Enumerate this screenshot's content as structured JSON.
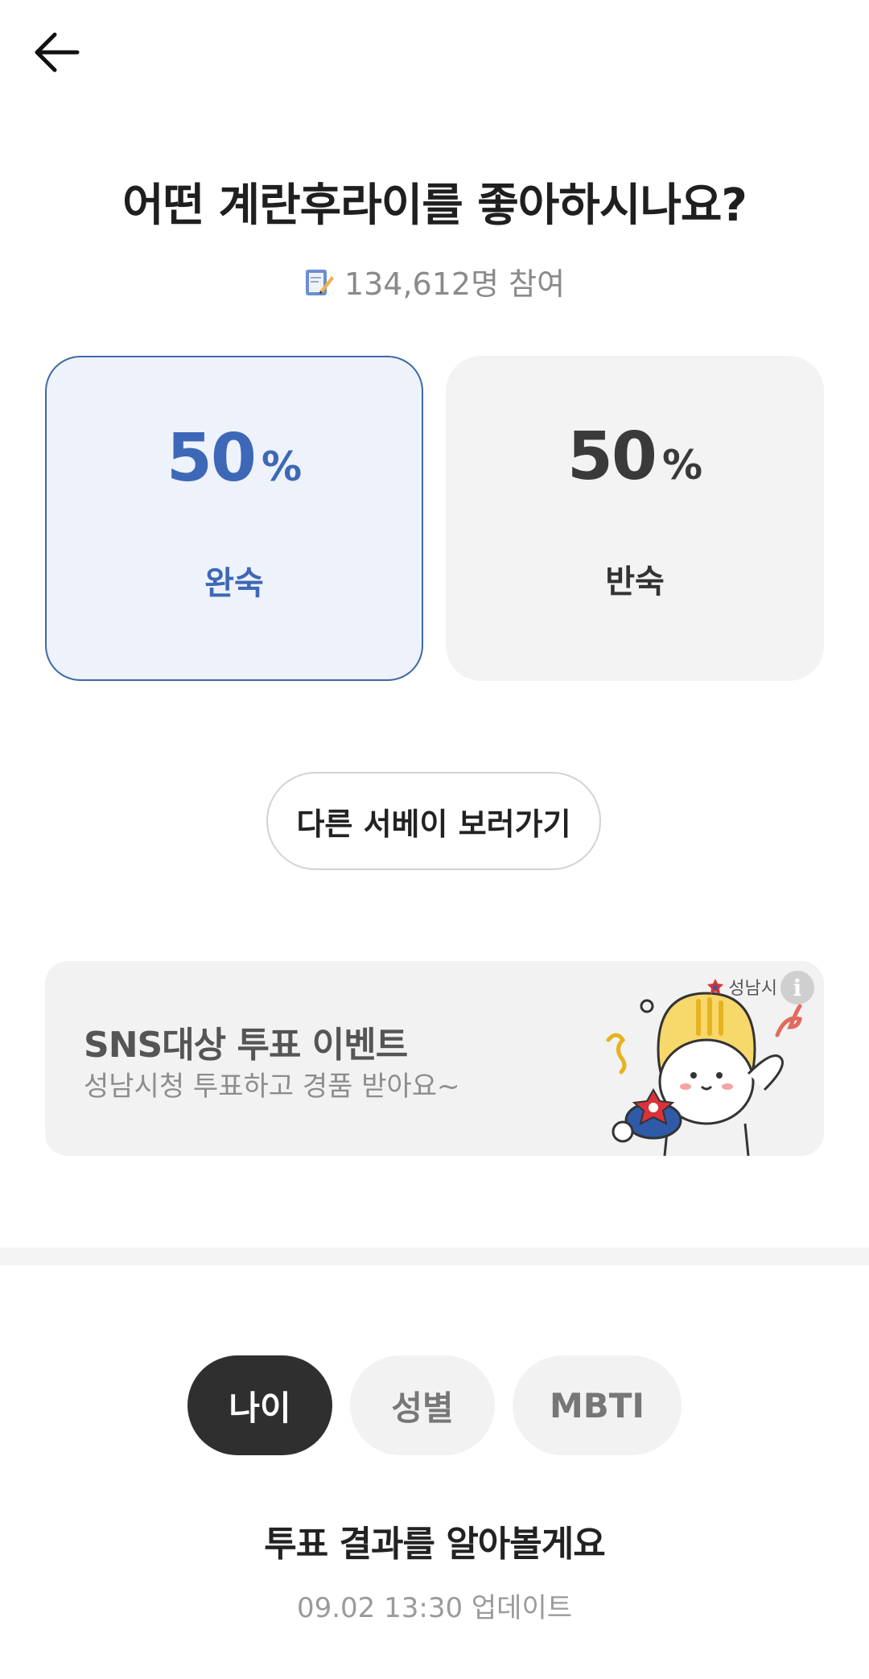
{
  "header": {
    "back_icon": "arrow-left-icon"
  },
  "question": {
    "title": "어떤 계란후라이를 좋아하시나요?",
    "participants_icon": "memo-icon",
    "participants": "134,612명 참여"
  },
  "options": [
    {
      "percent": "50",
      "unit": "%",
      "label": "완숙",
      "selected": true,
      "accent": "#3d68b7"
    },
    {
      "percent": "50",
      "unit": "%",
      "label": "반숙",
      "selected": false,
      "accent": "#3a3a3a"
    }
  ],
  "other_surveys_button": "다른 서베이 보러가기",
  "banner": {
    "title": "SNS대상 투표 이벤트",
    "subtitle": "성남시청 투표하고 경품 받아요~",
    "sponsor": "성남시",
    "info_icon": "info-icon",
    "art": "mascot-illustration"
  },
  "tabs": [
    {
      "label": "나이",
      "active": true
    },
    {
      "label": "성별",
      "active": false
    },
    {
      "label": "MBTI",
      "active": false
    }
  ],
  "results": {
    "title": "투표 결과를 알아볼게요",
    "updated": "09.02 13:30 업데이트"
  }
}
